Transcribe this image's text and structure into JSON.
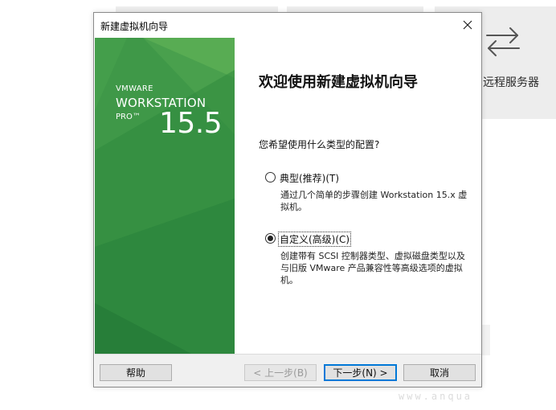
{
  "background": {
    "remote_label": "远程服务器",
    "remote_icon": "arrows-swap-icon",
    "watermark": "www.anqua"
  },
  "dialog": {
    "title": "新建虚拟机向导",
    "close_icon": "close-icon",
    "banner": {
      "vmware": "VMWARE",
      "product": "WORKSTATION",
      "edition": "PRO™",
      "version": "15.5",
      "color": "#3f9848"
    },
    "heading": "欢迎使用新建虚拟机向导",
    "question": "您希望使用什么类型的配置?",
    "options": [
      {
        "label": "典型(推荐)(T)",
        "description": "通过几个简单的步骤创建 Workstation 15.x 虚拟机。",
        "selected": false
      },
      {
        "label": "自定义(高级)(C)",
        "description": "创建带有 SCSI 控制器类型、虚拟磁盘类型以及与旧版 VMware 产品兼容性等高级选项的虚拟机。",
        "selected": true
      }
    ],
    "buttons": {
      "help": "帮助",
      "back": "< 上一步(B)",
      "next": "下一步(N) >",
      "cancel": "取消"
    }
  }
}
